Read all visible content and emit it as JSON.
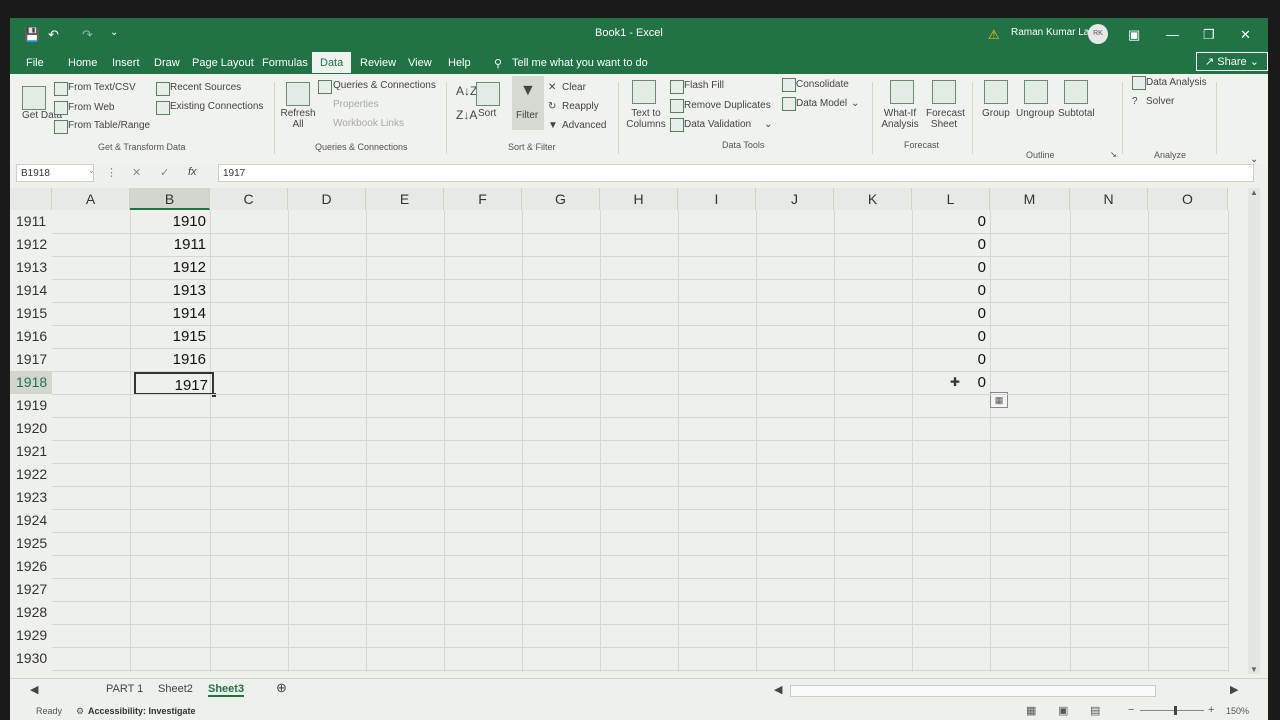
{
  "window": {
    "title": "Book1 - Excel",
    "user": "Raman Kumar Lal",
    "user_initials": "RK",
    "share_label": "Share"
  },
  "tabs": [
    "File",
    "Home",
    "Insert",
    "Draw",
    "Page Layout",
    "Formulas",
    "Data",
    "Review",
    "View",
    "Help"
  ],
  "active_tab": "Data",
  "tell_me": "Tell me what you want to do",
  "ribbon": {
    "get_transform": {
      "get_data": "Get Data",
      "from_text": "From Text/CSV",
      "from_web": "From Web",
      "from_table": "From Table/Range",
      "recent_sources": "Recent Sources",
      "existing_connections": "Existing Connections",
      "label": "Get & Transform Data"
    },
    "queries": {
      "refresh_all": "Refresh All",
      "queries_connections": "Queries & Connections",
      "properties": "Properties",
      "workbook_links": "Workbook Links",
      "label": "Queries & Connections"
    },
    "sort_filter": {
      "sort": "Sort",
      "filter": "Filter",
      "clear": "Clear",
      "reapply": "Reapply",
      "advanced": "Advanced",
      "label": "Sort & Filter"
    },
    "data_tools": {
      "text_to_columns": "Text to Columns",
      "flash_fill": "Flash Fill",
      "remove_duplicates": "Remove Duplicates",
      "data_validation": "Data Validation",
      "consolidate": "Consolidate",
      "data_model": "Data Model",
      "label": "Data Tools"
    },
    "forecast": {
      "what_if": "What-If Analysis",
      "forecast_sheet": "Forecast Sheet",
      "label": "Forecast"
    },
    "outline": {
      "group": "Group",
      "ungroup": "Ungroup",
      "subtotal": "Subtotal",
      "label": "Outline"
    },
    "analyze": {
      "data_analysis": "Data Analysis",
      "solver": "Solver",
      "label": "Analyze"
    }
  },
  "formula_bar": {
    "name_box": "B1918",
    "fx": "fx",
    "value": "1917"
  },
  "columns": [
    "A",
    "B",
    "C",
    "D",
    "E",
    "F",
    "G",
    "H",
    "I",
    "J",
    "K",
    "L",
    "M",
    "N",
    "O"
  ],
  "selected_column": "B",
  "rows": [
    {
      "num": "1911",
      "b": "1910",
      "l": "0"
    },
    {
      "num": "1912",
      "b": "1911",
      "l": "0"
    },
    {
      "num": "1913",
      "b": "1912",
      "l": "0"
    },
    {
      "num": "1914",
      "b": "1913",
      "l": "0"
    },
    {
      "num": "1915",
      "b": "1914",
      "l": "0"
    },
    {
      "num": "1916",
      "b": "1915",
      "l": "0"
    },
    {
      "num": "1917",
      "b": "1916",
      "l": "0"
    },
    {
      "num": "1918",
      "b": "1917",
      "l": "0"
    },
    {
      "num": "1919",
      "b": "",
      "l": ""
    },
    {
      "num": "1920",
      "b": "",
      "l": ""
    },
    {
      "num": "1921",
      "b": "",
      "l": ""
    },
    {
      "num": "1922",
      "b": "",
      "l": ""
    },
    {
      "num": "1923",
      "b": "",
      "l": ""
    },
    {
      "num": "1924",
      "b": "",
      "l": ""
    },
    {
      "num": "1925",
      "b": "",
      "l": ""
    },
    {
      "num": "1926",
      "b": "",
      "l": ""
    },
    {
      "num": "1927",
      "b": "",
      "l": ""
    },
    {
      "num": "1928",
      "b": "",
      "l": ""
    },
    {
      "num": "1929",
      "b": "",
      "l": ""
    },
    {
      "num": "1930",
      "b": "",
      "l": ""
    }
  ],
  "selected_row": "1918",
  "sheets": [
    "PART 1",
    "Sheet2",
    "Sheet3"
  ],
  "active_sheet": "Sheet3",
  "status": {
    "ready": "Ready",
    "accessibility": "Accessibility: Investigate",
    "zoom": "150%"
  }
}
